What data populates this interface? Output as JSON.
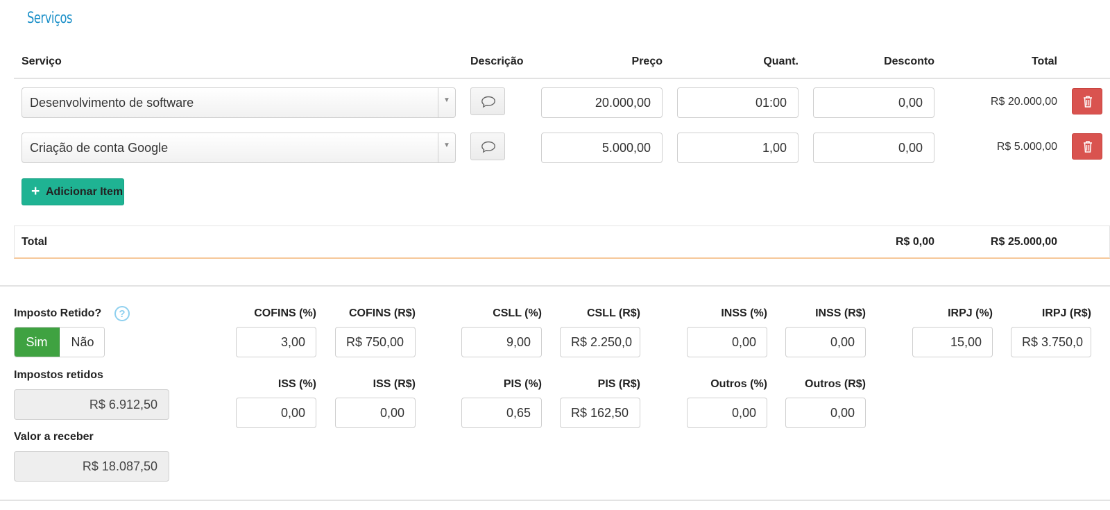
{
  "section_title": "Serviços",
  "table": {
    "headers": {
      "servico": "Serviço",
      "descricao": "Descrição",
      "preco": "Preço",
      "quant": "Quant.",
      "desconto": "Desconto",
      "total": "Total"
    },
    "rows": [
      {
        "servico": "Desenvolvimento de software",
        "preco": "20.000,00",
        "quant": "01:00",
        "desconto": "0,00",
        "total": "R$ 20.000,00"
      },
      {
        "servico": "Criação de conta Google",
        "preco": "5.000,00",
        "quant": "1,00",
        "desconto": "0,00",
        "total": "R$ 5.000,00"
      }
    ],
    "add_item_label": "Adicionar Item",
    "footer": {
      "label": "Total",
      "desconto_total": "R$ 0,00",
      "grand_total": "R$ 25.000,00"
    }
  },
  "taxes": {
    "retained_label": "Imposto Retido?",
    "help_icon": "?",
    "toggle": {
      "yes": "Sim",
      "no": "Não",
      "selected": "Sim"
    },
    "impostos_retidos_label": "Impostos retidos",
    "impostos_retidos_value": "R$ 6.912,50",
    "valor_receber_label": "Valor a receber",
    "valor_receber_value": "R$ 18.087,50",
    "fields": {
      "cofins_pct": {
        "label": "COFINS (%)",
        "value": "3,00"
      },
      "cofins_rs": {
        "label": "COFINS (R$)",
        "value": "R$ 750,00"
      },
      "csll_pct": {
        "label": "CSLL (%)",
        "value": "9,00"
      },
      "csll_rs": {
        "label": "CSLL (R$)",
        "value": "R$ 2.250,0"
      },
      "inss_pct": {
        "label": "INSS (%)",
        "value": "0,00"
      },
      "inss_rs": {
        "label": "INSS (R$)",
        "value": "0,00"
      },
      "irpj_pct": {
        "label": "IRPJ (%)",
        "value": "15,00"
      },
      "irpj_rs": {
        "label": "IRPJ (R$)",
        "value": "R$ 3.750,0"
      },
      "iss_pct": {
        "label": "ISS (%)",
        "value": "0,00"
      },
      "iss_rs": {
        "label": "ISS (R$)",
        "value": "0,00"
      },
      "pis_pct": {
        "label": "PIS (%)",
        "value": "0,65"
      },
      "pis_rs": {
        "label": "PIS (R$)",
        "value": "R$ 162,50"
      },
      "outros_pct": {
        "label": "Outros (%)",
        "value": "0,00"
      },
      "outros_rs": {
        "label": "Outros (R$)",
        "value": "0,00"
      }
    }
  },
  "colors": {
    "accent_blue": "#1a8fc8",
    "add_button": "#1fb393",
    "delete_button": "#d9534f",
    "toggle_active": "#3fa241",
    "total_underline": "#f6c89a"
  }
}
